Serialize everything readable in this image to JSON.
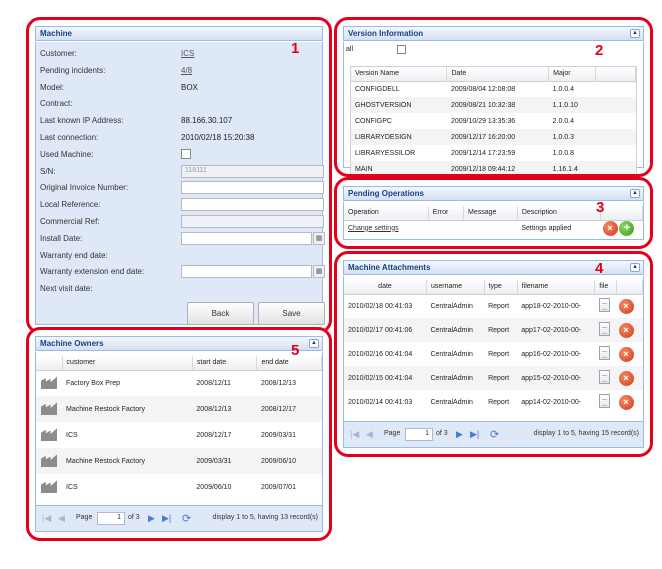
{
  "badges": [
    "1",
    "2",
    "3",
    "4",
    "5"
  ],
  "machine": {
    "title": "Machine",
    "fields": [
      {
        "label": "Customer:",
        "value": "ICS",
        "kind": "link"
      },
      {
        "label": "Pending incidents:",
        "value": "4/8",
        "kind": "link"
      },
      {
        "label": "Model:",
        "value": "BOX",
        "kind": "text"
      },
      {
        "label": "Contract:",
        "value": "",
        "kind": "text"
      },
      {
        "label": "Last known IP Address:",
        "value": "88.166.30.107",
        "kind": "text"
      },
      {
        "label": "Last connection:",
        "value": "2010/02/18 15:20:38",
        "kind": "text"
      },
      {
        "label": "Used Machine:",
        "value": "",
        "kind": "checkbox"
      },
      {
        "label": "S/N:",
        "value": "118111",
        "kind": "disabled"
      },
      {
        "label": "Original Invoice Number:",
        "value": "",
        "kind": "input"
      },
      {
        "label": "Local Reference:",
        "value": "",
        "kind": "input"
      },
      {
        "label": "Commercial Ref:",
        "value": "",
        "kind": "disabled"
      },
      {
        "label": "Install Date:",
        "value": "",
        "kind": "date"
      },
      {
        "label": "Warranty end date:",
        "value": "",
        "kind": "text"
      },
      {
        "label": "Warranty extension end date:",
        "value": "",
        "kind": "date"
      },
      {
        "label": "Next visit date:",
        "value": "",
        "kind": "text"
      }
    ],
    "back_label": "Back",
    "save_label": "Save"
  },
  "version": {
    "title": "Version Information",
    "filter_label": "all",
    "columns": [
      "Version Name",
      "Date",
      "Major"
    ],
    "rows": [
      [
        "CONFIGDELL",
        "2009/08/04 12:08:08",
        "1.0.0.4"
      ],
      [
        "GHOSTVERSION",
        "2009/08/21 10:32:38",
        "1.1.0.10"
      ],
      [
        "CONFIGPC",
        "2009/10/29 13:35:36",
        "2.0.0.4"
      ],
      [
        "LIBRARYDESIGN",
        "2009/12/17 16:20:00",
        "1.0.0.3"
      ],
      [
        "LIBRARYESSILOR",
        "2009/12/14 17:23:59",
        "1.0.0.8"
      ],
      [
        "MAIN",
        "2009/12/18 09:44:12",
        "1.16.1.4"
      ]
    ]
  },
  "pending": {
    "title": "Pending Operations",
    "columns": [
      "Operation",
      "Error",
      "Message",
      "Description"
    ],
    "row": {
      "operation": "Change settings",
      "error": "",
      "message": "",
      "description": "Settings applied"
    }
  },
  "attachments": {
    "title": "Machine Attachments",
    "columns": [
      "date",
      "username",
      "type",
      "filename",
      "file"
    ],
    "rows": [
      [
        "2010/02/18 00:41:03",
        "CentralAdmin",
        "Report",
        "app18-02-2010-00-"
      ],
      [
        "2010/02/17 00:41:06",
        "CentralAdmin",
        "Report",
        "app17-02-2010-00-"
      ],
      [
        "2010/02/16 00:41:04",
        "CentralAdmin",
        "Report",
        "app16-02-2010-00-"
      ],
      [
        "2010/02/15 00:41:04",
        "CentralAdmin",
        "Report",
        "app15-02-2010-00-"
      ],
      [
        "2010/02/14 00:41:03",
        "CentralAdmin",
        "Report",
        "app14-02-2010-00-"
      ]
    ],
    "pager": {
      "page_label": "Page",
      "page": "1",
      "of": "of 3",
      "display": "display 1 to 5, having 15 record(s)"
    }
  },
  "owners": {
    "title": "Machine Owners",
    "columns": [
      "customer",
      "start date",
      "end date"
    ],
    "rows": [
      [
        "Factory Box Prep",
        "2008/12/11",
        "2008/12/13"
      ],
      [
        "Machine Restock Factory",
        "2008/12/13",
        "2008/12/17"
      ],
      [
        "ICS",
        "2008/12/17",
        "2009/03/31"
      ],
      [
        "Machine Restock Factory",
        "2009/03/31",
        "2009/06/10"
      ],
      [
        "ICS",
        "2009/06/10",
        "2009/07/01"
      ]
    ],
    "pager": {
      "page_label": "Page",
      "page": "1",
      "of": "of 3",
      "display": "display 1 to 5, having 13 record(s)"
    }
  }
}
